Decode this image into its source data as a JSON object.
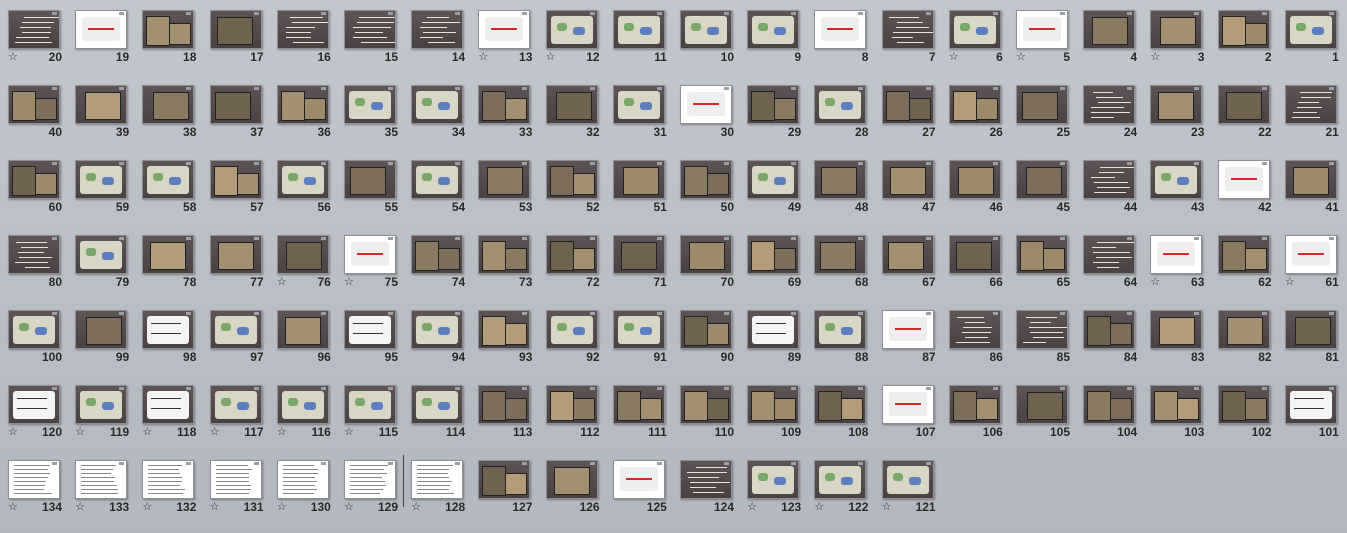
{
  "sorter": {
    "transition_icon": "star-transition-icon",
    "colors": {
      "slide_dark": "#564c4e",
      "slide_white": "#ffffff",
      "accent_red": "#d4282a"
    },
    "rows": [
      {
        "slides": [
          {
            "n": "20",
            "style": "text",
            "star": true
          },
          {
            "n": "19",
            "style": "white-red",
            "star": false
          },
          {
            "n": "18",
            "style": "photo2",
            "star": false
          },
          {
            "n": "17",
            "style": "photo1",
            "star": false
          },
          {
            "n": "16",
            "style": "text",
            "star": false
          },
          {
            "n": "15",
            "style": "text",
            "star": false
          },
          {
            "n": "14",
            "style": "text",
            "star": false
          },
          {
            "n": "13",
            "style": "white-red",
            "star": true
          },
          {
            "n": "12",
            "style": "map",
            "star": true
          },
          {
            "n": "11",
            "style": "map",
            "star": false
          },
          {
            "n": "10",
            "style": "map",
            "star": false
          },
          {
            "n": "9",
            "style": "map",
            "star": false
          },
          {
            "n": "8",
            "style": "white-red",
            "star": false
          },
          {
            "n": "7",
            "style": "text",
            "star": false
          },
          {
            "n": "6",
            "style": "map",
            "star": true
          },
          {
            "n": "5",
            "style": "white-red",
            "star": true
          },
          {
            "n": "4",
            "style": "photo1",
            "star": false
          },
          {
            "n": "3",
            "style": "photo1",
            "star": true
          },
          {
            "n": "2",
            "style": "photo2",
            "star": false
          },
          {
            "n": "1",
            "style": "map",
            "star": false
          }
        ]
      },
      {
        "slides": [
          {
            "n": "40",
            "style": "photo2",
            "star": false
          },
          {
            "n": "39",
            "style": "photo1",
            "star": false
          },
          {
            "n": "38",
            "style": "photo1",
            "star": false
          },
          {
            "n": "37",
            "style": "photo1",
            "star": false
          },
          {
            "n": "36",
            "style": "photo2",
            "star": false
          },
          {
            "n": "35",
            "style": "map",
            "star": false
          },
          {
            "n": "34",
            "style": "map",
            "star": false
          },
          {
            "n": "33",
            "style": "photo2",
            "star": false
          },
          {
            "n": "32",
            "style": "photo1",
            "star": false
          },
          {
            "n": "31",
            "style": "map",
            "star": false
          },
          {
            "n": "30",
            "style": "white-red",
            "star": false
          },
          {
            "n": "29",
            "style": "photo2",
            "star": false
          },
          {
            "n": "28",
            "style": "map",
            "star": false
          },
          {
            "n": "27",
            "style": "photo2",
            "star": false
          },
          {
            "n": "26",
            "style": "photo2",
            "star": false
          },
          {
            "n": "25",
            "style": "photo1",
            "star": false
          },
          {
            "n": "24",
            "style": "text",
            "star": false
          },
          {
            "n": "23",
            "style": "photo1",
            "star": false
          },
          {
            "n": "22",
            "style": "photo1",
            "star": false
          },
          {
            "n": "21",
            "style": "text",
            "star": false
          }
        ]
      },
      {
        "slides": [
          {
            "n": "60",
            "style": "photo2",
            "star": false
          },
          {
            "n": "59",
            "style": "map",
            "star": false
          },
          {
            "n": "58",
            "style": "map",
            "star": false
          },
          {
            "n": "57",
            "style": "photo2",
            "star": false
          },
          {
            "n": "56",
            "style": "map",
            "star": false
          },
          {
            "n": "55",
            "style": "photo1",
            "star": false
          },
          {
            "n": "54",
            "style": "map",
            "star": false
          },
          {
            "n": "53",
            "style": "photo1",
            "star": false
          },
          {
            "n": "52",
            "style": "photo2",
            "star": false
          },
          {
            "n": "51",
            "style": "photo1",
            "star": false
          },
          {
            "n": "50",
            "style": "photo2",
            "star": false
          },
          {
            "n": "49",
            "style": "map",
            "star": false
          },
          {
            "n": "48",
            "style": "photo1",
            "star": false
          },
          {
            "n": "47",
            "style": "photo1",
            "star": false
          },
          {
            "n": "46",
            "style": "photo1",
            "star": false
          },
          {
            "n": "45",
            "style": "photo1",
            "star": false
          },
          {
            "n": "44",
            "style": "text",
            "star": false
          },
          {
            "n": "43",
            "style": "map",
            "star": false
          },
          {
            "n": "42",
            "style": "white-red",
            "star": false
          },
          {
            "n": "41",
            "style": "photo1",
            "star": false
          }
        ]
      },
      {
        "slides": [
          {
            "n": "80",
            "style": "text",
            "star": false
          },
          {
            "n": "79",
            "style": "map",
            "star": false
          },
          {
            "n": "78",
            "style": "photo1",
            "star": false
          },
          {
            "n": "77",
            "style": "photo1",
            "star": false
          },
          {
            "n": "76",
            "style": "photo1",
            "star": true
          },
          {
            "n": "75",
            "style": "white-red",
            "star": true
          },
          {
            "n": "74",
            "style": "photo2",
            "star": false
          },
          {
            "n": "73",
            "style": "photo2",
            "star": false
          },
          {
            "n": "72",
            "style": "photo2",
            "star": false
          },
          {
            "n": "71",
            "style": "photo1",
            "star": false
          },
          {
            "n": "70",
            "style": "photo1",
            "star": false
          },
          {
            "n": "69",
            "style": "photo2",
            "star": false
          },
          {
            "n": "68",
            "style": "photo1",
            "star": false
          },
          {
            "n": "67",
            "style": "photo1",
            "star": false
          },
          {
            "n": "66",
            "style": "photo1",
            "star": false
          },
          {
            "n": "65",
            "style": "photo2",
            "star": false
          },
          {
            "n": "64",
            "style": "text",
            "star": false
          },
          {
            "n": "63",
            "style": "white-red",
            "star": true
          },
          {
            "n": "62",
            "style": "photo2",
            "star": false
          },
          {
            "n": "61",
            "style": "white-red",
            "star": true
          }
        ]
      },
      {
        "slides": [
          {
            "n": "100",
            "style": "map",
            "star": false
          },
          {
            "n": "99",
            "style": "photo1",
            "star": false
          },
          {
            "n": "98",
            "style": "plan",
            "star": false
          },
          {
            "n": "97",
            "style": "map",
            "star": false
          },
          {
            "n": "96",
            "style": "photo1",
            "star": false
          },
          {
            "n": "95",
            "style": "plan",
            "star": false
          },
          {
            "n": "94",
            "style": "map",
            "star": false
          },
          {
            "n": "93",
            "style": "photo2",
            "star": false
          },
          {
            "n": "92",
            "style": "map",
            "star": false
          },
          {
            "n": "91",
            "style": "map",
            "star": false
          },
          {
            "n": "90",
            "style": "photo2",
            "star": false
          },
          {
            "n": "89",
            "style": "plan",
            "star": false
          },
          {
            "n": "88",
            "style": "map",
            "star": false
          },
          {
            "n": "87",
            "style": "white-red",
            "star": false
          },
          {
            "n": "86",
            "style": "text",
            "star": false
          },
          {
            "n": "85",
            "style": "text",
            "star": false
          },
          {
            "n": "84",
            "style": "photo2",
            "star": false
          },
          {
            "n": "83",
            "style": "photo1",
            "star": false
          },
          {
            "n": "82",
            "style": "photo1",
            "star": false
          },
          {
            "n": "81",
            "style": "photo1",
            "star": false
          }
        ]
      },
      {
        "slides": [
          {
            "n": "120",
            "style": "plan",
            "star": true
          },
          {
            "n": "119",
            "style": "map",
            "star": true
          },
          {
            "n": "118",
            "style": "plan",
            "star": true
          },
          {
            "n": "117",
            "style": "map",
            "star": true
          },
          {
            "n": "116",
            "style": "map",
            "star": true
          },
          {
            "n": "115",
            "style": "map",
            "star": true
          },
          {
            "n": "114",
            "style": "map",
            "star": false
          },
          {
            "n": "113",
            "style": "photo2",
            "star": false
          },
          {
            "n": "112",
            "style": "photo2",
            "star": false
          },
          {
            "n": "111",
            "style": "photo2",
            "star": false
          },
          {
            "n": "110",
            "style": "photo2",
            "star": false
          },
          {
            "n": "109",
            "style": "photo2",
            "star": false
          },
          {
            "n": "108",
            "style": "photo2",
            "star": false
          },
          {
            "n": "107",
            "style": "white-red",
            "star": false
          },
          {
            "n": "106",
            "style": "photo2",
            "star": false
          },
          {
            "n": "105",
            "style": "photo1",
            "star": false
          },
          {
            "n": "104",
            "style": "photo2",
            "star": false
          },
          {
            "n": "103",
            "style": "photo2",
            "star": false
          },
          {
            "n": "102",
            "style": "photo2",
            "star": false
          },
          {
            "n": "101",
            "style": "plan",
            "star": false
          }
        ]
      },
      {
        "slides": [
          {
            "n": "134",
            "style": "white-text",
            "star": true
          },
          {
            "n": "133",
            "style": "white-text",
            "star": true
          },
          {
            "n": "132",
            "style": "white-text",
            "star": true
          },
          {
            "n": "131",
            "style": "white-text",
            "star": true
          },
          {
            "n": "130",
            "style": "white-text",
            "star": true
          },
          {
            "n": "129",
            "style": "white-text",
            "star": true
          },
          {
            "n": "128",
            "style": "white-text",
            "star": true
          },
          {
            "n": "127",
            "style": "photo2",
            "star": false
          },
          {
            "n": "126",
            "style": "photo1",
            "star": false
          },
          {
            "n": "125",
            "style": "white-red",
            "star": false
          },
          {
            "n": "124",
            "style": "text",
            "star": false
          },
          {
            "n": "123",
            "style": "map",
            "star": true
          },
          {
            "n": "122",
            "style": "map",
            "star": true
          },
          {
            "n": "121",
            "style": "map",
            "star": true
          }
        ]
      }
    ]
  }
}
